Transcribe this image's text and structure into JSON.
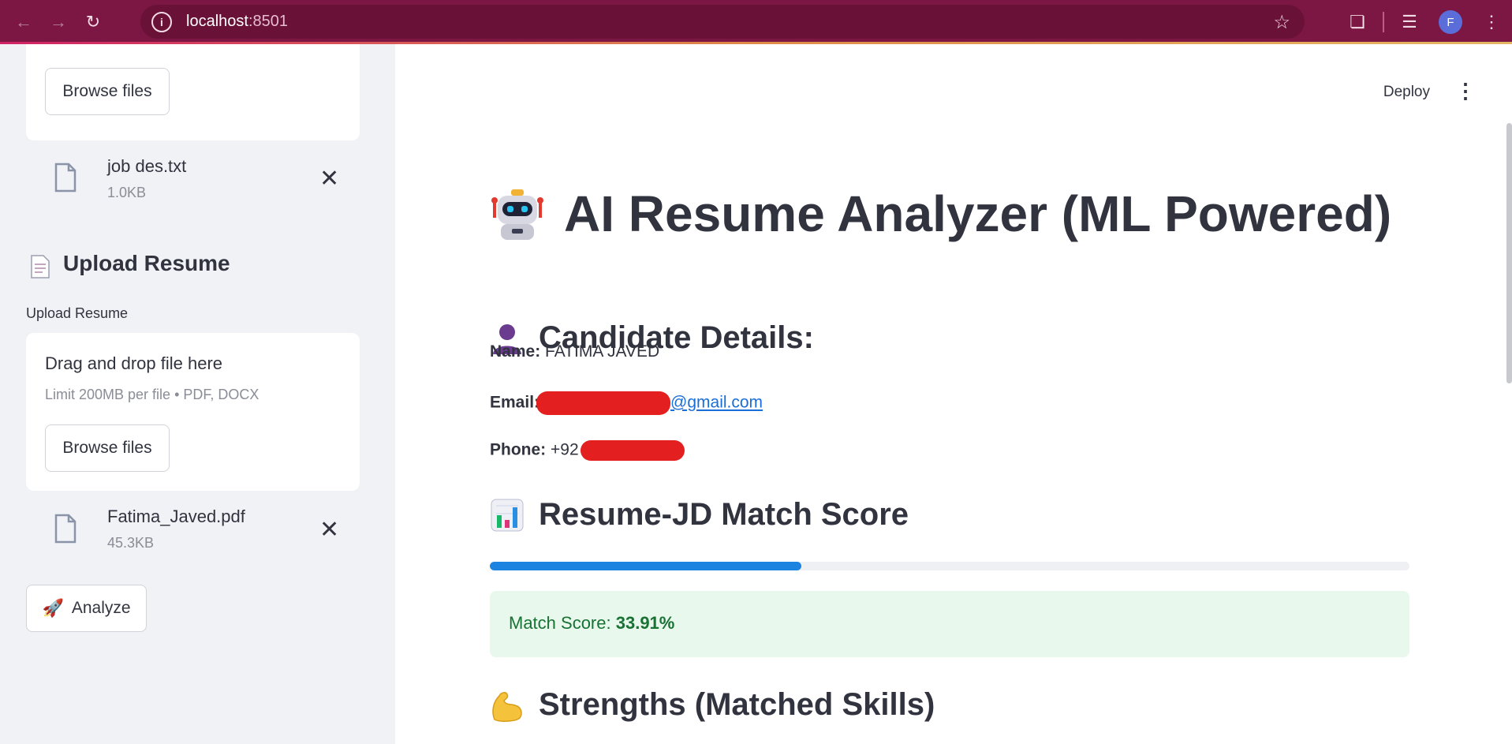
{
  "browser": {
    "url_host": "localhost",
    "url_port": ":8501",
    "profile_initial": "F",
    "chrome_color": "#7c1744"
  },
  "sidebar": {
    "top_browse_label": "Browse files",
    "job_file": {
      "name": "job des.txt",
      "size": "1.0KB"
    },
    "resume_header": "Upload Resume",
    "resume_label": "Upload Resume",
    "dropzone": {
      "title": "Drag and drop file here",
      "limit": "Limit 200MB per file • PDF, DOCX",
      "browse_label": "Browse files"
    },
    "resume_file": {
      "name": "Fatima_Javed.pdf",
      "size": "45.3KB"
    },
    "analyze_label": "Analyze"
  },
  "header": {
    "deploy_label": "Deploy"
  },
  "main": {
    "title": "AI Resume Analyzer (ML Powered)",
    "candidate_header": "Candidate Details:",
    "name_label": "Name:",
    "name_value": "FATIMA JAVED",
    "email_label": "Email:",
    "email_visible": "@gmail.com",
    "phone_label": "Phone:",
    "phone_visible": "+92",
    "match_header": "Resume-JD Match Score",
    "match_fraction": 0.3391,
    "match_label": "Match Score:",
    "match_value": "33.91%",
    "strengths_header": "Strengths (Matched Skills)"
  },
  "colors": {
    "accent": "#1c83e1",
    "success_bg": "#e9f8ec",
    "success_text": "#177233",
    "redaction": "#e41f1f"
  }
}
